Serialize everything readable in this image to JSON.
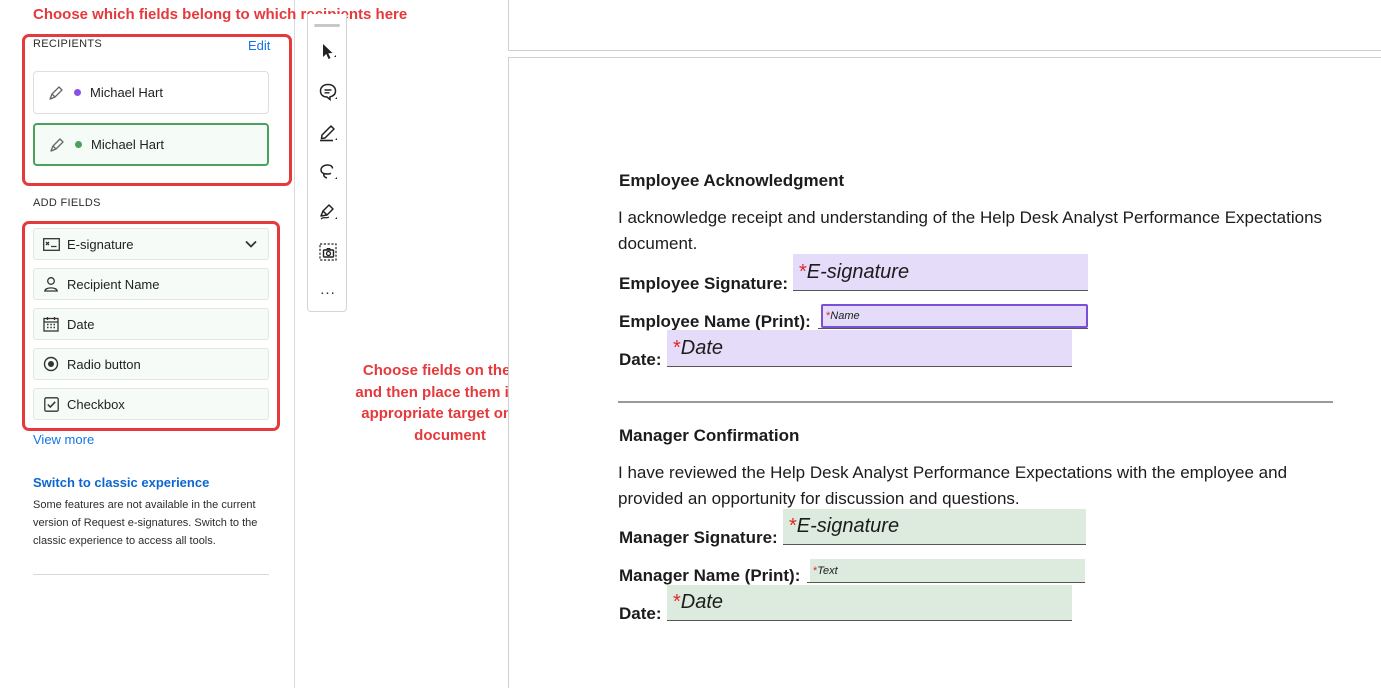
{
  "annotations": {
    "top": "Choose which fields belong to which recipients here",
    "middle": "Choose fields on the left and then place them in the appropriate target on the document"
  },
  "sidebar": {
    "recipients_label": "RECIPIENTS",
    "edit_label": "Edit",
    "recipients": [
      {
        "name": "Michael Hart",
        "color": "#8a4fe8"
      },
      {
        "name": "Michael Hart",
        "color": "#4aa05d"
      }
    ],
    "add_fields_label": "ADD FIELDS",
    "fields": [
      {
        "label": "E-signature",
        "icon": "e-signature-icon"
      },
      {
        "label": "Recipient Name",
        "icon": "person-icon"
      },
      {
        "label": "Date",
        "icon": "calendar-icon"
      },
      {
        "label": "Radio button",
        "icon": "radio-icon"
      },
      {
        "label": "Checkbox",
        "icon": "checkbox-icon"
      }
    ],
    "view_more": "View more",
    "switch_title": "Switch to classic experience",
    "switch_desc": "Some features are not available in the current version of Request e-signatures. Switch to the classic experience to access all tools."
  },
  "toolbar": {
    "tools": [
      "select-arrow-icon",
      "comment-icon",
      "highlight-pen-icon",
      "lasso-icon",
      "fill-sign-icon",
      "snapshot-icon"
    ],
    "more": "..."
  },
  "document": {
    "employee": {
      "heading": "Employee Acknowledgment",
      "paragraph": "I acknowledge receipt and understanding of the Help Desk Analyst Performance Expectations document.",
      "signature_label": "Employee Signature:",
      "signature_field": "E-signature",
      "name_label": "Employee Name (Print):",
      "name_field": "Name",
      "date_label": "Date:",
      "date_field": "Date"
    },
    "manager": {
      "heading": "Manager Confirmation",
      "paragraph": "I have reviewed the Help Desk Analyst Performance Expectations with the employee and provided an opportunity for discussion and questions.",
      "signature_label": "Manager Signature:",
      "signature_field": "E-signature",
      "name_label": "Manager Name (Print):",
      "name_field": "Text",
      "date_label": "Date:",
      "date_field": "Date"
    },
    "required_mark": "*"
  },
  "colors": {
    "annotation_red": "#e5393c",
    "accent_blue": "#1473e6",
    "recipient1": "#8a4fe8",
    "recipient2": "#4aa05d",
    "field_purple": "#e4dcf9",
    "field_green": "#dcebdd"
  }
}
